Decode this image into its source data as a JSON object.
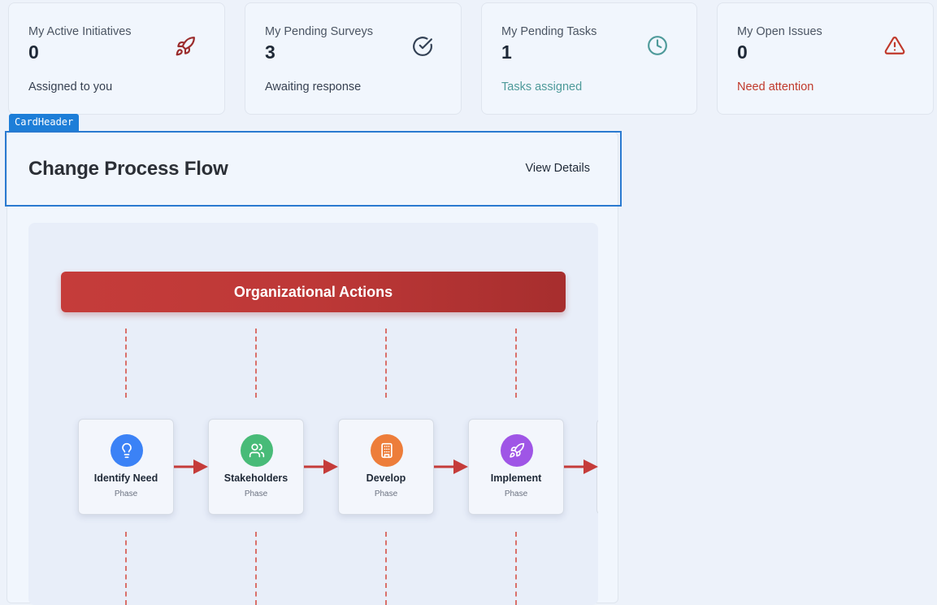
{
  "stats": [
    {
      "title": "My Active Initiatives",
      "value": "0",
      "subtitle": "Assigned to you",
      "subtitle_color": "#374151",
      "icon": "rocket-icon",
      "icon_color": "#9b2c2c"
    },
    {
      "title": "My Pending Surveys",
      "value": "3",
      "subtitle": "Awaiting response",
      "subtitle_color": "#374151",
      "icon": "check-circle-icon",
      "icon_color": "#334155"
    },
    {
      "title": "My Pending Tasks",
      "value": "1",
      "subtitle": "Tasks assigned",
      "subtitle_color": "#4e9a9a",
      "icon": "clock-icon",
      "icon_color": "#4e9a9a"
    },
    {
      "title": "My Open Issues",
      "value": "0",
      "subtitle": "Need attention",
      "subtitle_color": "#c0392b",
      "icon": "alert-triangle-icon",
      "icon_color": "#c0392b"
    }
  ],
  "dev_tag": "CardHeader",
  "flow_card": {
    "title": "Change Process Flow",
    "view_details": "View Details"
  },
  "diagram": {
    "banner": "Organizational Actions",
    "banner_color": "#c53c3a",
    "arrow_color": "#c53c3a",
    "phases": [
      {
        "name": "Identify Need",
        "sub": "Phase",
        "icon": "lightbulb-icon",
        "color": "#3b82f6"
      },
      {
        "name": "Stakeholders",
        "sub": "Phase",
        "icon": "users-icon",
        "color": "#48bb78"
      },
      {
        "name": "Develop",
        "sub": "Phase",
        "icon": "building-icon",
        "color": "#ed7d3a"
      },
      {
        "name": "Implement",
        "sub": "Phase",
        "icon": "rocket-icon",
        "color": "#9f55e6"
      }
    ]
  }
}
